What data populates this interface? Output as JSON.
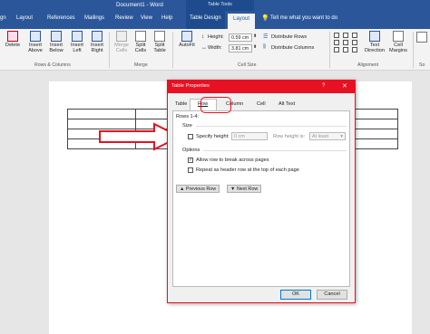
{
  "titlebar": {
    "doc_title": "Document1 - Word",
    "tools_title": "Table Tools"
  },
  "tabs": {
    "t0": "gn",
    "t1": "Layout",
    "t2": "References",
    "t3": "Mailings",
    "t4": "Review",
    "t5": "View",
    "t6": "Help",
    "t7": "Table Design",
    "t8": "Layout",
    "tell": "Tell me what you want to do"
  },
  "ribbon": {
    "delete": "Delete",
    "insert_above_1": "Insert",
    "insert_above_2": "Above",
    "insert_below_1": "Insert",
    "insert_below_2": "Below",
    "insert_left_1": "Insert",
    "insert_left_2": "Left",
    "insert_right_1": "Insert",
    "insert_right_2": "Right",
    "merge_cells_1": "Merge",
    "merge_cells_2": "Cells",
    "split_cells_1": "Split",
    "split_cells_2": "Cells",
    "split_table_1": "Split",
    "split_table_2": "Table",
    "autofit": "AutoFit",
    "height_label": "Height:",
    "height_value": "0.59 cm",
    "width_label": "Width:",
    "width_value": "3.81 cm",
    "distribute_rows": "Distribute Rows",
    "distribute_columns": "Distribute Columns",
    "text_direction_1": "Text",
    "text_direction_2": "Direction",
    "cell_margins_1": "Cell",
    "cell_margins_2": "Margins",
    "grp_rows_columns": "Rows & Columns",
    "grp_merge": "Merge",
    "grp_cell_size": "Cell Size",
    "grp_alignment": "Alignment",
    "grp_so": "So"
  },
  "dialog": {
    "title": "Table Properties",
    "help": "?",
    "close": "✕",
    "tabs": {
      "table": "Table",
      "row": "Row",
      "column": "Column",
      "cell": "Cell",
      "alt_text": "Alt Text"
    },
    "rows_label": "Rows 1-4:",
    "size_label": "Size",
    "specify_height": "Specify height:",
    "height_value": "0 cm",
    "row_height_is": "Row height is:",
    "row_height_value": "At least",
    "options_label": "Options",
    "allow_break": "Allow row to break across pages",
    "repeat_header": "Repeat as header row at the top of each page",
    "prev_row": "Previous Row",
    "next_row": "Next Row",
    "ok": "OK",
    "cancel": "Cancel"
  },
  "colors": {
    "accent": "#2b579a",
    "highlight": "#e81123"
  }
}
